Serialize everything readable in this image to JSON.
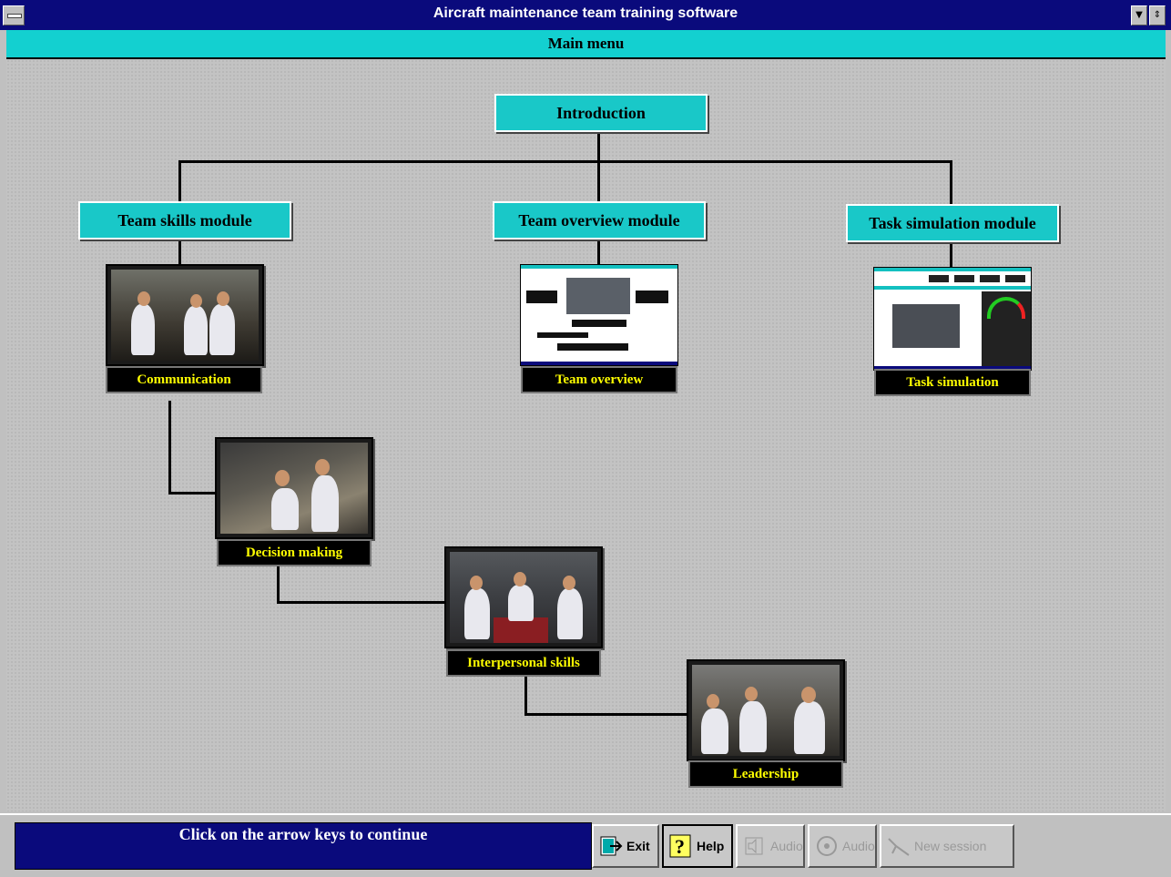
{
  "window": {
    "title": "Aircraft maintenance team training software",
    "system_menu_icon": "system-menu-icon",
    "minimize_glyph": "▼",
    "restore_glyph": "⇕"
  },
  "menubar": {
    "title": "Main menu"
  },
  "tree": {
    "root": "Introduction",
    "modules": [
      {
        "label": "Team skills module"
      },
      {
        "label": "Team overview module"
      },
      {
        "label": "Task simulation module"
      }
    ],
    "thumbnails": {
      "communication": "Communication",
      "team_overview": "Team overview",
      "task_simulation": "Task simulation",
      "decision_making": "Decision making",
      "interpersonal": "Interpersonal skills",
      "leadership": "Leadership"
    }
  },
  "status": {
    "message": "Click on the arrow keys to continue"
  },
  "buttons": {
    "exit": {
      "label": "Exit",
      "icon": "exit-icon"
    },
    "help": {
      "label": "Help",
      "icon": "help-icon"
    },
    "audio1": {
      "label": "Audio",
      "icon": "audio-speaker-icon"
    },
    "audio2": {
      "label": "Audio",
      "icon": "audio-cd-icon"
    },
    "new_session": {
      "label": "New session",
      "icon": "new-session-icon"
    }
  }
}
